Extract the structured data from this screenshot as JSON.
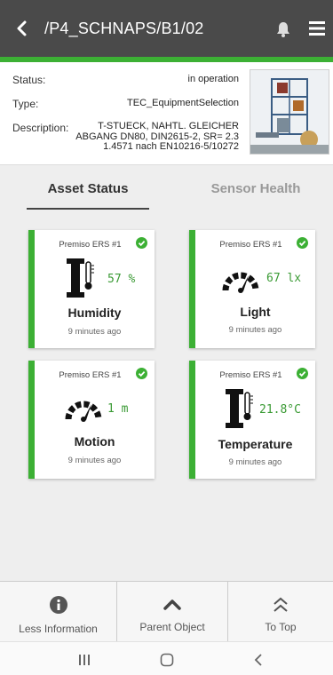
{
  "header": {
    "path": "/P4_SCHNAPS/B1/02",
    "back_icon": "chevron-left-icon",
    "bell_icon": "bell-icon",
    "menu_icon": "hamburger-menu-icon"
  },
  "colors": {
    "topbar": "#4a4a4a",
    "accent": "#3cb034",
    "value_text": "#3a9a34"
  },
  "info": {
    "status_label": "Status:",
    "status_value": "in operation",
    "type_label": "Type:",
    "type_value": "TEC_EquipmentSelection",
    "description_label": "Description:",
    "description_lines": [
      "T-STUECK, NAHTL. GLEICHER",
      "ABGANG DN80, DIN2615-2, SR= 2.3",
      "1.4571 nach EN10216-5/10272"
    ]
  },
  "tabs": [
    {
      "label": "Asset Status",
      "active": true
    },
    {
      "label": "Sensor Health",
      "active": false
    }
  ],
  "cards": [
    {
      "sensor": "Premiso ERS #1",
      "icon": "thermometer-icon",
      "value": "57 %",
      "name": "Humidity",
      "time": "9 minutes ago"
    },
    {
      "sensor": "Premiso ERS #1",
      "icon": "gauge-icon",
      "value": "67 lx",
      "name": "Light",
      "time": "9 minutes ago"
    },
    {
      "sensor": "Premiso ERS #1",
      "icon": "gauge-icon",
      "value": "1 m",
      "name": "Motion",
      "time": "9 minutes ago"
    },
    {
      "sensor": "Premiso ERS #1",
      "icon": "thermometer-icon",
      "value": "21.8°C",
      "name": "Temperature",
      "time": "9 minutes ago"
    }
  ],
  "bottom": [
    {
      "label": "Less Information",
      "icon": "info-circle-icon"
    },
    {
      "label": "Parent Object",
      "icon": "chevron-up-icon"
    },
    {
      "label": "To Top",
      "icon": "double-chevron-up-icon"
    }
  ],
  "android_nav": {
    "recents_icon": "recents-icon",
    "home_icon": "home-icon",
    "back_icon": "back-icon"
  }
}
